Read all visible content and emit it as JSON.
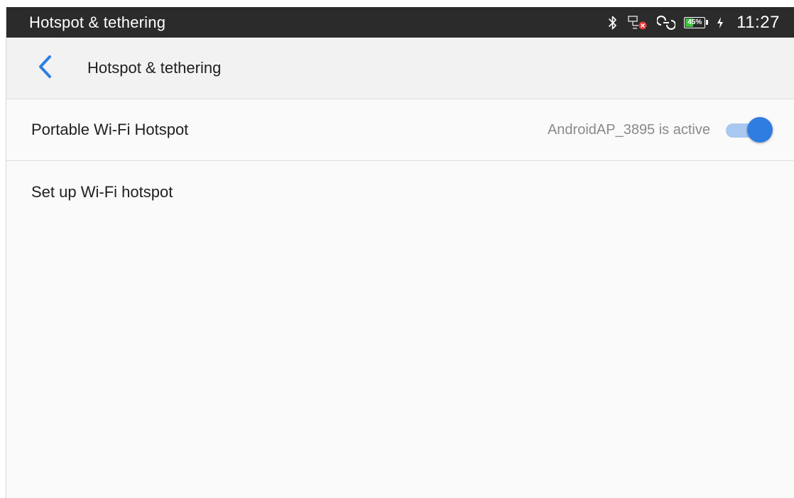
{
  "status_bar": {
    "title": "Hotspot & tethering",
    "icons": [
      "bluetooth-icon",
      "ethernet-disconnected-icon",
      "hotspot-icon",
      "battery-icon",
      "charging-icon"
    ],
    "battery": {
      "label": "45%",
      "level": 0.45,
      "color": "#3cc23c"
    },
    "time": "11:27"
  },
  "app_bar": {
    "back_icon": "chevron-left-icon",
    "title": "Hotspot & tethering",
    "accent": "#2f7de1"
  },
  "settings": [
    {
      "title": "Portable Wi-Fi Hotspot",
      "summary": "AndroidAP_3895 is active",
      "toggle": true
    },
    {
      "title": "Set up Wi-Fi hotspot"
    }
  ]
}
